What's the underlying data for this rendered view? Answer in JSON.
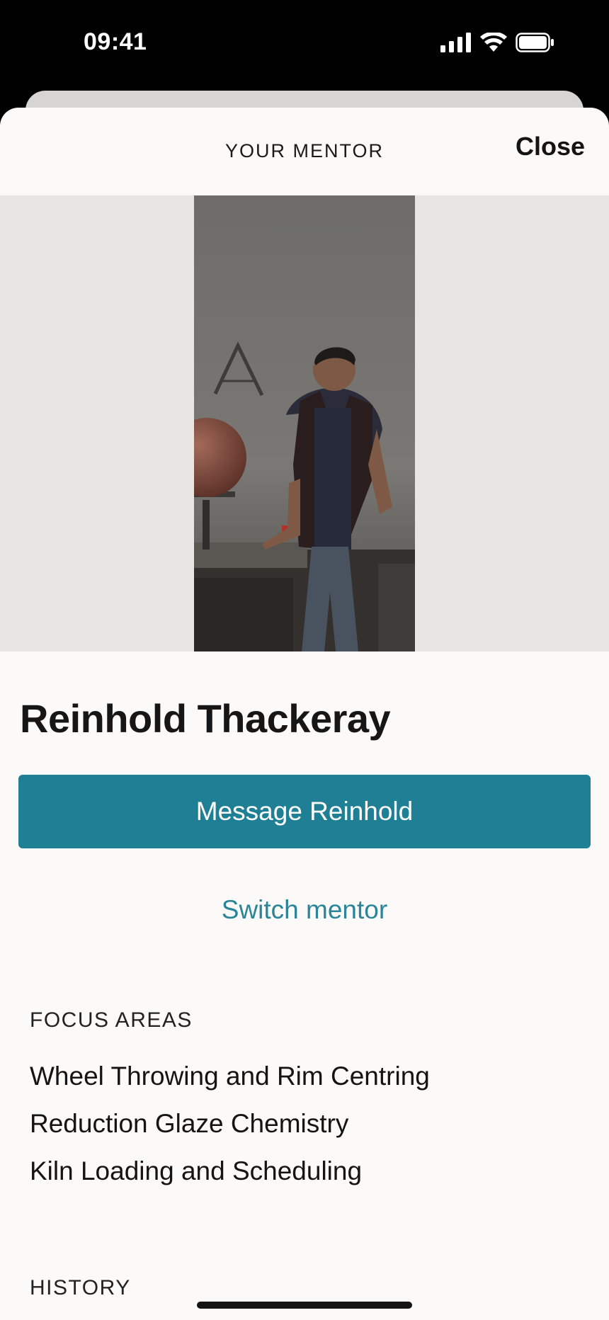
{
  "status_bar": {
    "time": "09:41",
    "icons": [
      "cellular-signal-icon",
      "wifi-icon",
      "battery-icon"
    ]
  },
  "header": {
    "title": "YOUR MENTOR",
    "close_label": "Close"
  },
  "mentor": {
    "name": "Reinhold Thackeray",
    "photo_description": "mentor-portrait-photo"
  },
  "actions": {
    "message_label": "Message Reinhold",
    "switch_label": "Switch mentor"
  },
  "focus_areas": {
    "label": "FOCUS AREAS",
    "items": [
      "Wheel Throwing and Rim Centring",
      "Reduction Glaze Chemistry",
      "Kiln Loading and Scheduling"
    ]
  },
  "history": {
    "label": "HISTORY"
  },
  "colors": {
    "accent": "#1f7f95",
    "link": "#2a8598",
    "sheet_background": "#fbfaf8",
    "photo_band": "#e8e6e3"
  }
}
